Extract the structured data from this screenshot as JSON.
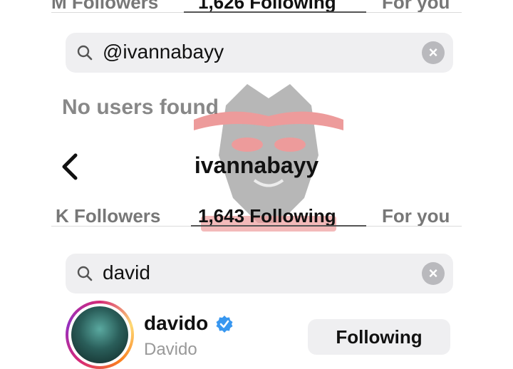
{
  "top_tabs": {
    "followers_label": "M Followers",
    "following_label": "1,626 Following",
    "for_you_label": "For you"
  },
  "search_top": {
    "query": "@ivannabayy",
    "clear_icon": "×"
  },
  "empty_state": "No users found",
  "profile_header": {
    "title": "ivannabayy",
    "back_icon": "chevron-left-icon"
  },
  "tabs": {
    "followers_label": "K Followers",
    "following_label": "1,643 Following",
    "for_you_label": "For you"
  },
  "search": {
    "query": "david",
    "clear_icon": "×"
  },
  "users": [
    {
      "username": "davido",
      "subtitle": "Davido",
      "verified": true,
      "button_label": "Following"
    }
  ],
  "colors": {
    "verified_blue": "#3897f0",
    "watermark_red": "#e04a4a"
  }
}
